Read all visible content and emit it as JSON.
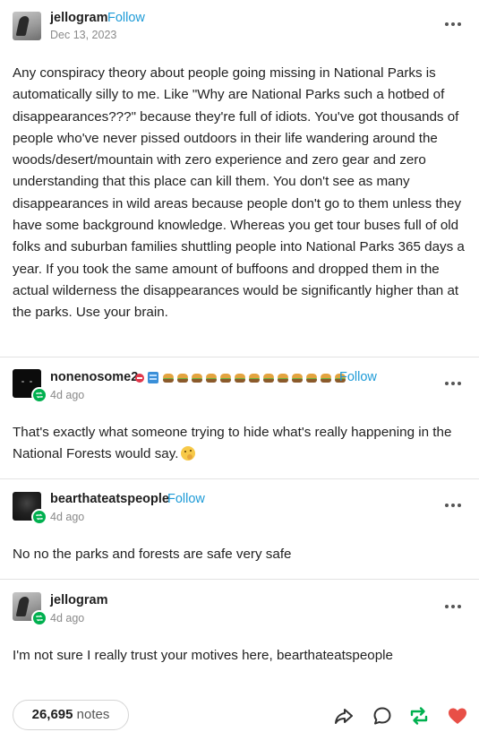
{
  "colors": {
    "follow": "#1e9bd7",
    "reblog_green": "#00b04f",
    "like_red": "#e84f47"
  },
  "original_post": {
    "username": "jellogram",
    "follow_label": "Follow",
    "date": "Dec 13, 2023",
    "text": "Any conspiracy theory about people going missing in National Parks is automatically silly to me. Like \"Why are National Parks such a hotbed of disappearances???\" because they're full of idiots. You've got thousands of people who've never pissed outdoors in their life wandering around the woods/desert/mountain with zero experience and zero gear and zero understanding that this place can kill them. You don't see as many disappearances in wild areas because people don't go to them unless they have some background knowledge. Whereas you get tour buses full of old folks and suburban families shuttling people into National Parks 365 days a year. If you took the same amount of buffoons and dropped them in the actual wilderness the disappearances would be significantly higher than at the parks. Use your brain."
  },
  "reblogs": [
    {
      "username": "nonenosome2",
      "follow_label": "Follow",
      "time": "4d ago",
      "text": "That's exactly what someone trying to hide what's really happening in the National Forests would say.",
      "badge_icons": [
        "red-badge-icon",
        "blue-badge-icon",
        "burger-icon",
        "burger-icon",
        "burger-icon",
        "burger-icon",
        "burger-icon",
        "burger-icon",
        "burger-icon",
        "burger-icon",
        "burger-icon",
        "burger-icon",
        "burger-icon",
        "burger-icon",
        "burger-icon"
      ]
    },
    {
      "username": "bearthateatspeople",
      "follow_label": "Follow",
      "time": "4d ago",
      "text": "No no the parks and forests are safe very safe"
    },
    {
      "username": "jellogram",
      "time": "4d ago",
      "text": "I'm not sure I really trust your motives here, bearthateatspeople"
    }
  ],
  "footer": {
    "notes_count": "26,695",
    "notes_label": "notes",
    "icons": [
      "share-icon",
      "reply-icon",
      "reblog-icon",
      "like-icon"
    ]
  }
}
